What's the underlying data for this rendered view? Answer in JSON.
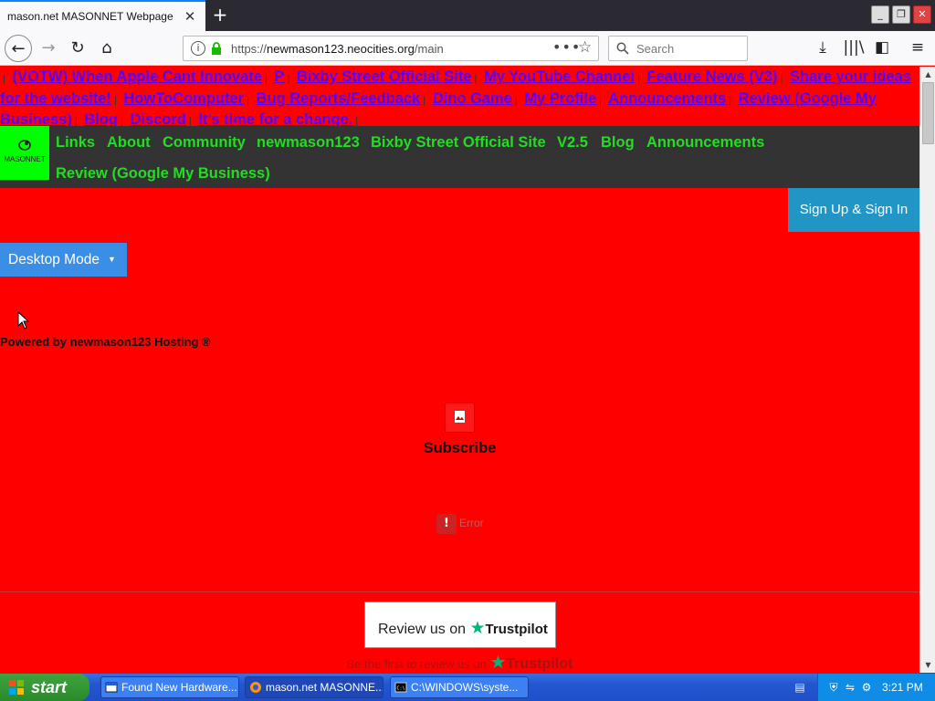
{
  "browser": {
    "tab_title": "mason.net MASONNET Webpage",
    "url_prefix": "https://",
    "url_host": "newmason123.neocities.org",
    "url_path": "/main",
    "search_placeholder": "Search"
  },
  "top_links": [
    "(VOTW) When Apple Cant Innovate",
    "P",
    "Bixby Street Official Site",
    "My YouTube Channel",
    "Feature News (V3)",
    "Share your ideas for the website!",
    "HowToComputer",
    "Bug Reports/Feedback",
    "Dino Game",
    "My Profile",
    "Announcements",
    "Review (Google My Business)",
    "Blog",
    "Discord",
    "It's time for a change."
  ],
  "site_nav": {
    "logo_text": "MASONNET",
    "items": [
      "Links",
      "About",
      "Community",
      "newmason123",
      "Bixby Street Official Site",
      "V2.5",
      "Blog",
      "Announcements",
      "Review (Google My Business)"
    ]
  },
  "signup_label": "Sign Up & Sign In",
  "desktop_mode_label": "Desktop Mode",
  "powered_by": "Powered by newmason123 Hosting ®",
  "subscribe_label": "Subscribe",
  "error_label": "Error",
  "trustpilot": {
    "review_text": "Review us on",
    "brand": "Trustpilot",
    "first_text": "Be the first to review us on"
  },
  "taskbar": {
    "start_label": "start",
    "tasks": [
      "Found New Hardware...",
      "mason.net MASONNE...",
      "C:\\WINDOWS\\syste..."
    ],
    "clock": "3:21 PM"
  },
  "colors": {
    "page_bg": "#ff0000",
    "link_color": "#5500ff",
    "nav_bg": "#333333",
    "nav_link": "#22dd22",
    "logo_bg": "#00ff00",
    "signup_bg": "#2196c6",
    "desktop_btn_bg": "#3a8ee6",
    "trustpilot_green": "#00b67a"
  }
}
